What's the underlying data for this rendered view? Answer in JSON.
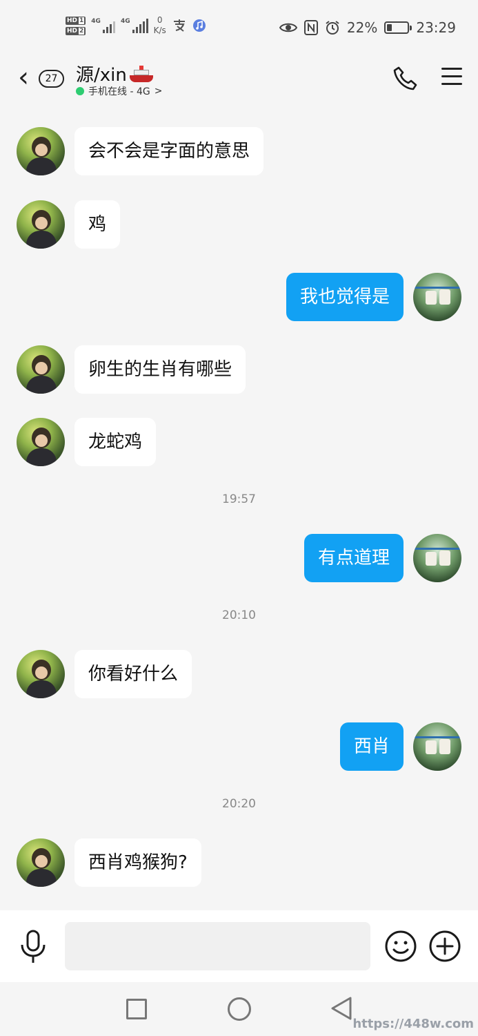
{
  "status_bar": {
    "sim1_label": "HD",
    "sim1_num": "1",
    "sim2_label": "HD",
    "sim2_num": "2",
    "network1": "4G",
    "network2": "4G",
    "speed_value": "0",
    "speed_unit": "K/s",
    "battery_percent": "22%",
    "battery_level": 0.22,
    "time": "23:29",
    "icons": [
      "alipay-icon",
      "music-icon",
      "eye-icon",
      "nfc-icon",
      "alarm-icon"
    ]
  },
  "header": {
    "back_icon": "chevron-left-icon",
    "unread_count": "27",
    "title": "源/xin",
    "title_emoji": "ship-icon",
    "status_text": "手机在线 - 4G",
    "status_chevron": ">",
    "status_color": "#2ecc71",
    "actions": [
      "phone-icon",
      "menu-icon"
    ]
  },
  "messages": [
    {
      "side": "in",
      "text": "会不会是字面的意思"
    },
    {
      "side": "in",
      "text": "鸡"
    },
    {
      "side": "out",
      "text": "我也觉得是"
    },
    {
      "side": "in",
      "text": "卵生的生肖有哪些"
    },
    {
      "side": "in",
      "text": "龙蛇鸡"
    },
    {
      "type": "time",
      "text": "19:57"
    },
    {
      "side": "out",
      "text": "有点道理"
    },
    {
      "type": "time",
      "text": "20:10"
    },
    {
      "side": "in",
      "text": "你看好什么"
    },
    {
      "side": "out",
      "text": "西肖"
    },
    {
      "type": "time",
      "text": "20:20"
    },
    {
      "side": "in",
      "text": "西肖鸡猴狗?"
    }
  ],
  "input_bar": {
    "placeholder": "",
    "icons": [
      "mic-icon",
      "emoji-icon",
      "plus-icon"
    ]
  },
  "nav_bar": {
    "icons": [
      "recent-apps-icon",
      "home-icon",
      "back-triangle-icon"
    ]
  },
  "watermark": "https://448w.com",
  "colors": {
    "outgoing_bubble": "#12a1f3",
    "incoming_bubble": "#ffffff",
    "background": "#f5f5f5"
  }
}
